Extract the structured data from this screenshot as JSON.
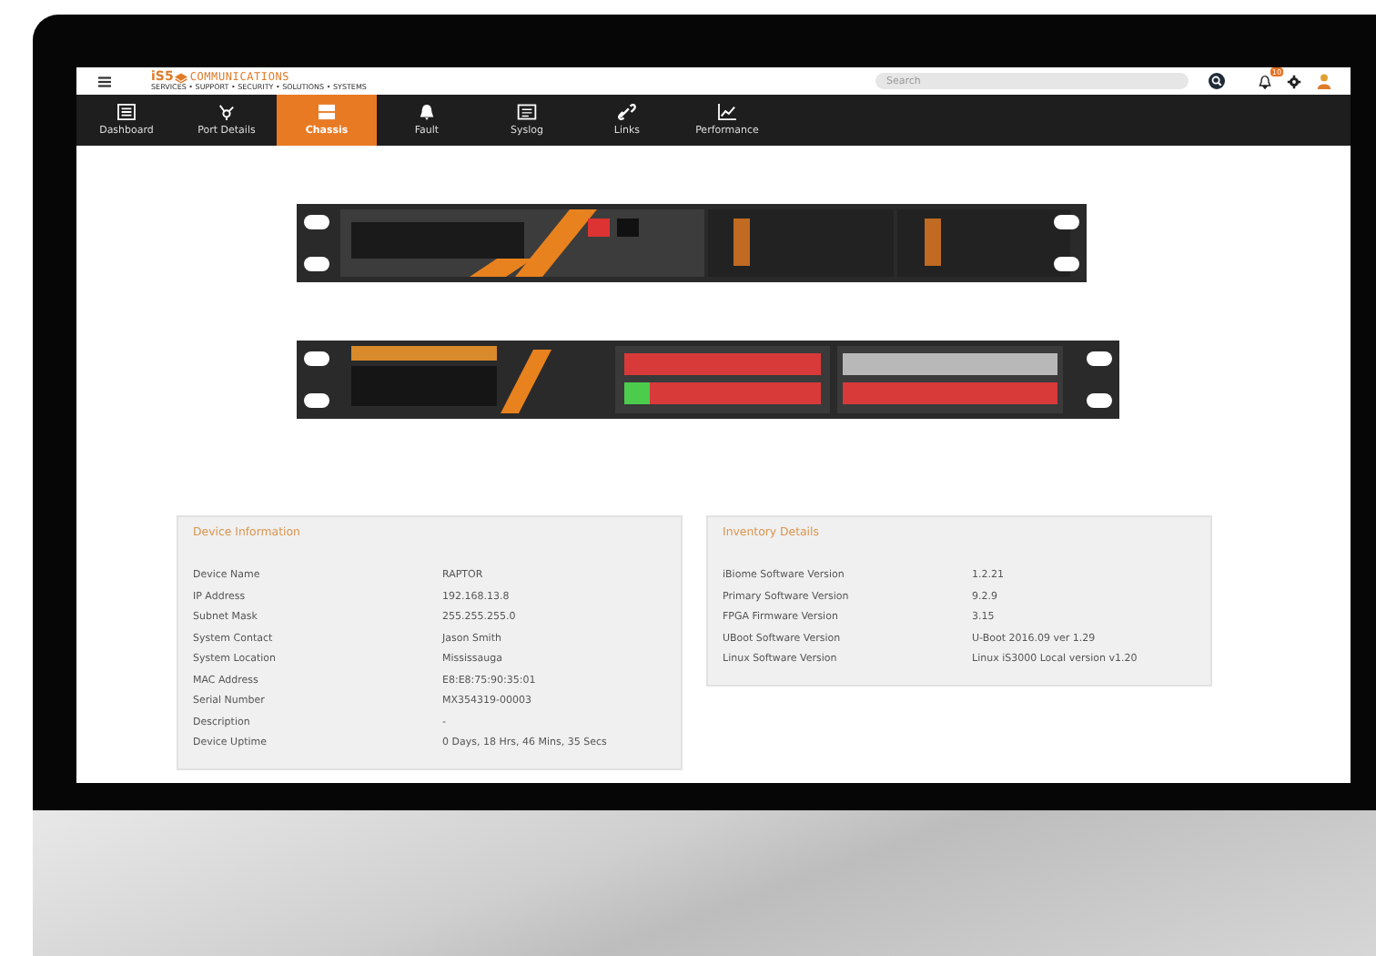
{
  "header": {
    "logo": {
      "mark": "iS5",
      "name": "COMMUNICATIONS",
      "tagline": "SERVICES • SUPPORT • SECURITY • SOLUTIONS • SYSTEMS"
    },
    "search": {
      "placeholder": "Search"
    },
    "notifications": {
      "count": "10"
    }
  },
  "tabs": [
    {
      "label": "Dashboard",
      "selected": false
    },
    {
      "label": "Port Details",
      "selected": false
    },
    {
      "label": "Chassis",
      "selected": true
    },
    {
      "label": "Fault",
      "selected": false
    },
    {
      "label": "Syslog",
      "selected": false
    },
    {
      "label": "Links",
      "selected": false
    },
    {
      "label": "Performance",
      "selected": false
    }
  ],
  "cards": [
    {
      "title": "Device Information",
      "rows": [
        {
          "label": "Device Name",
          "value": "RAPTOR"
        },
        {
          "label": "IP Address",
          "value": "192.168.13.8"
        },
        {
          "label": "Subnet Mask",
          "value": "255.255.255.0"
        },
        {
          "label": "System Contact",
          "value": "Jason Smith"
        },
        {
          "label": "System Location",
          "value": "Mississauga"
        },
        {
          "label": "MAC Address",
          "value": "E8:E8:75:90:35:01"
        },
        {
          "label": "Serial Number",
          "value": "MX354319-00003"
        },
        {
          "label": "Description",
          "value": "-"
        },
        {
          "label": "Device Uptime",
          "value": "0 Days, 18 Hrs, 46 Mins, 35 Secs"
        }
      ]
    },
    {
      "title": "Inventory Details",
      "rows": [
        {
          "label": "iBiome Software Version",
          "value": "1.2.21"
        },
        {
          "label": "Primary Software Version",
          "value": "9.2.9"
        },
        {
          "label": "FPGA Firmware Version",
          "value": "3.15"
        },
        {
          "label": "UBoot Software Version",
          "value": "U-Boot 2016.09 ver 1.29"
        },
        {
          "label": "Linux Software Version",
          "value": "Linux iS3000 Local version v1.20"
        }
      ]
    }
  ]
}
